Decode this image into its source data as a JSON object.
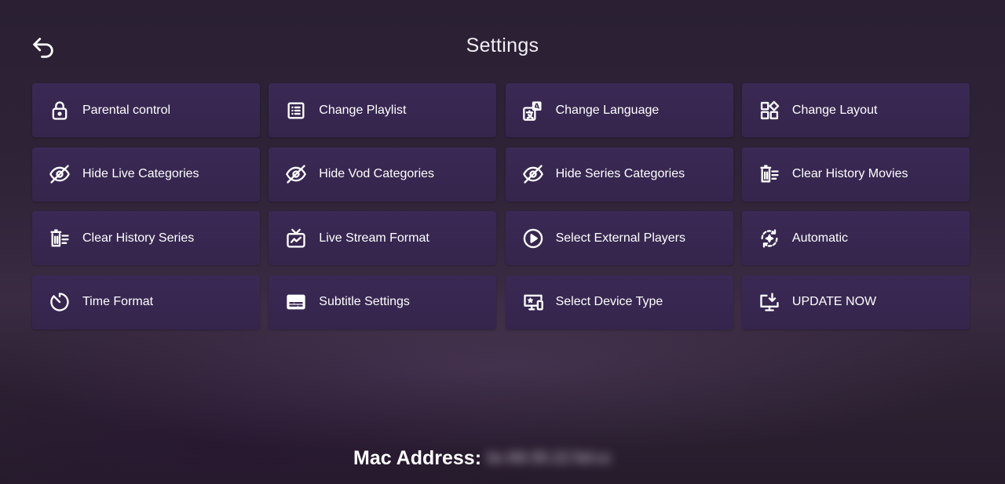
{
  "header": {
    "title": "Settings",
    "back_icon": "undo-arrow-icon"
  },
  "tiles": [
    {
      "label": "Parental control",
      "icon": "lock-icon"
    },
    {
      "label": "Change Playlist",
      "icon": "list-icon"
    },
    {
      "label": "Change Language",
      "icon": "translate-icon"
    },
    {
      "label": "Change Layout",
      "icon": "layout-icon"
    },
    {
      "label": "Hide Live Categories",
      "icon": "eye-off-icon"
    },
    {
      "label": "Hide Vod Categories",
      "icon": "eye-off-icon"
    },
    {
      "label": "Hide Series Categories",
      "icon": "eye-off-icon"
    },
    {
      "label": "Clear History Movies",
      "icon": "clear-history-icon"
    },
    {
      "label": "Clear History Series",
      "icon": "clear-history-icon"
    },
    {
      "label": "Live Stream Format",
      "icon": "tv-icon"
    },
    {
      "label": "Select External Players",
      "icon": "play-circle-icon"
    },
    {
      "label": "Automatic",
      "icon": "auto-refresh-icon"
    },
    {
      "label": "Time Format",
      "icon": "timer-icon"
    },
    {
      "label": "Subtitle Settings",
      "icon": "subtitles-icon"
    },
    {
      "label": "Select Device Type",
      "icon": "devices-icon"
    },
    {
      "label": "UPDATE NOW",
      "icon": "download-icon"
    }
  ],
  "footer": {
    "mac_label": "Mac Address:",
    "mac_value": "bc:69:35:22:5d:cc"
  },
  "colors": {
    "tile_background": "#3a2954",
    "page_background": "#2e2337",
    "text": "#ffffff"
  }
}
